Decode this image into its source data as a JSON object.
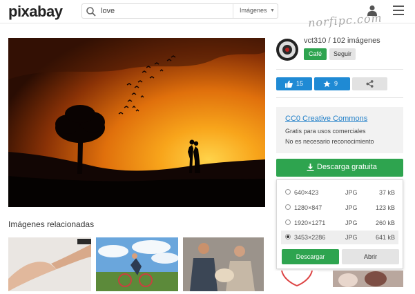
{
  "header": {
    "logo": "pixabay",
    "search_query": "love",
    "search_type": "Imágenes",
    "watermark": "norfipc.com"
  },
  "main": {
    "photo_icon": "sunset-couple-silhouette-photo",
    "related_title": "Imágenes relacionadas"
  },
  "sidebar": {
    "author": "vct310 / 102 imágenes",
    "cafe_label": "Café",
    "follow_label": "Seguir",
    "likes": "15",
    "favorites": "9",
    "license": {
      "title": "CC0 Creative Commons",
      "line1": "Gratis para usos comerciales",
      "line2": "No es necesario reconocimiento"
    },
    "download_label": "Descarga gratuita",
    "sizes": [
      {
        "dim": "640×423",
        "fmt": "JPG",
        "size": "37 kB",
        "selected": false
      },
      {
        "dim": "1280×847",
        "fmt": "JPG",
        "size": "123 kB",
        "selected": false
      },
      {
        "dim": "1920×1271",
        "fmt": "JPG",
        "size": "260 kB",
        "selected": false
      },
      {
        "dim": "3453×2286",
        "fmt": "JPG",
        "size": "641 kB",
        "selected": true
      }
    ],
    "descargar_label": "Descargar",
    "abrir_label": "Abrir"
  },
  "colors": {
    "green": "#2ea44f",
    "blue": "#1f8ad4",
    "link": "#1e7ec8"
  }
}
